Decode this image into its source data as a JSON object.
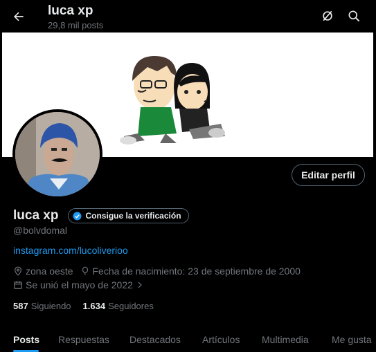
{
  "header": {
    "title": "luca xp",
    "posts_count": "29,8 mil posts"
  },
  "profile": {
    "display_name": "luca xp",
    "verify_label": "Consigue la verificación",
    "handle": "@bolvdomal",
    "website": "instagram.com/lucoliverioo",
    "location": "zona oeste",
    "birthday": "Fecha de nacimiento: 23 de septiembre de 2000",
    "joined": "Se unió el mayo de 2022",
    "following_count": "587",
    "following_label": "Siguiendo",
    "followers_count": "1.634",
    "followers_label": "Seguidores"
  },
  "actions": {
    "edit_profile": "Editar perfil"
  },
  "tabs": [
    {
      "label": "Posts",
      "active": true
    },
    {
      "label": "Respuestas",
      "active": false
    },
    {
      "label": "Destacados",
      "active": false
    },
    {
      "label": "Artículos",
      "active": false
    },
    {
      "label": "Multimedia",
      "active": false
    },
    {
      "label": "Me gusta",
      "active": false
    }
  ],
  "colors": {
    "background": "#000000",
    "text_primary": "#e7e9ea",
    "text_secondary": "#71767b",
    "accent": "#1d9bf0",
    "border": "#536471"
  },
  "icons": {
    "back": "arrow-left-icon",
    "grok": "grok-icon",
    "search": "search-icon",
    "verified": "verified-badge-icon",
    "location": "location-pin-icon",
    "birthday": "balloon-icon",
    "calendar": "calendar-icon",
    "chevron": "chevron-right-icon"
  }
}
